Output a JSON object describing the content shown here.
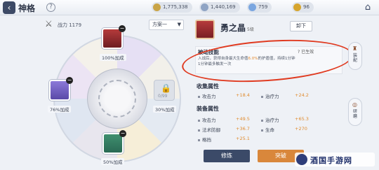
{
  "header": {
    "title": "神格",
    "resources": [
      "1,775,338",
      "1,440,169",
      "759",
      "96"
    ]
  },
  "left": {
    "power_label": "战力 1179",
    "plan_select": "方案一",
    "gems": [
      {
        "label": "100%加成"
      },
      {
        "label": "76%加成"
      },
      {
        "label": "30%加成"
      },
      {
        "label": "50%加成"
      }
    ],
    "locked_count": "0/99"
  },
  "detail": {
    "name": "勇之晶",
    "level": "5级",
    "unload_button": "卸下",
    "skill": {
      "title": "被动技能",
      "status": "已生效",
      "desc_a": "入战后，获得自身最大生命值",
      "desc_hl": "6.0%",
      "desc_b": "的护盾值，持续1分钟",
      "desc_c": "1分钟最多触发一次"
    },
    "collect_title": "收集属性",
    "collect_stats": [
      {
        "name": "攻击力",
        "value": "+18.4"
      },
      {
        "name": "治疗力",
        "value": "+24.2"
      }
    ],
    "equip_title": "装备属性",
    "equip_stats": [
      {
        "name": "攻击力",
        "value": "+49.5"
      },
      {
        "name": "治疗力",
        "value": "+65.3"
      },
      {
        "name": "法术防御",
        "value": "+36.7"
      },
      {
        "name": "生命",
        "value": "+270"
      },
      {
        "name": "格挡",
        "value": "+25.1"
      }
    ],
    "refine_button": "修炼",
    "break_button": "突破"
  },
  "side": {
    "equip_tab": "装配",
    "refine_tab": "研磨"
  },
  "watermark": "酒国手游网"
}
